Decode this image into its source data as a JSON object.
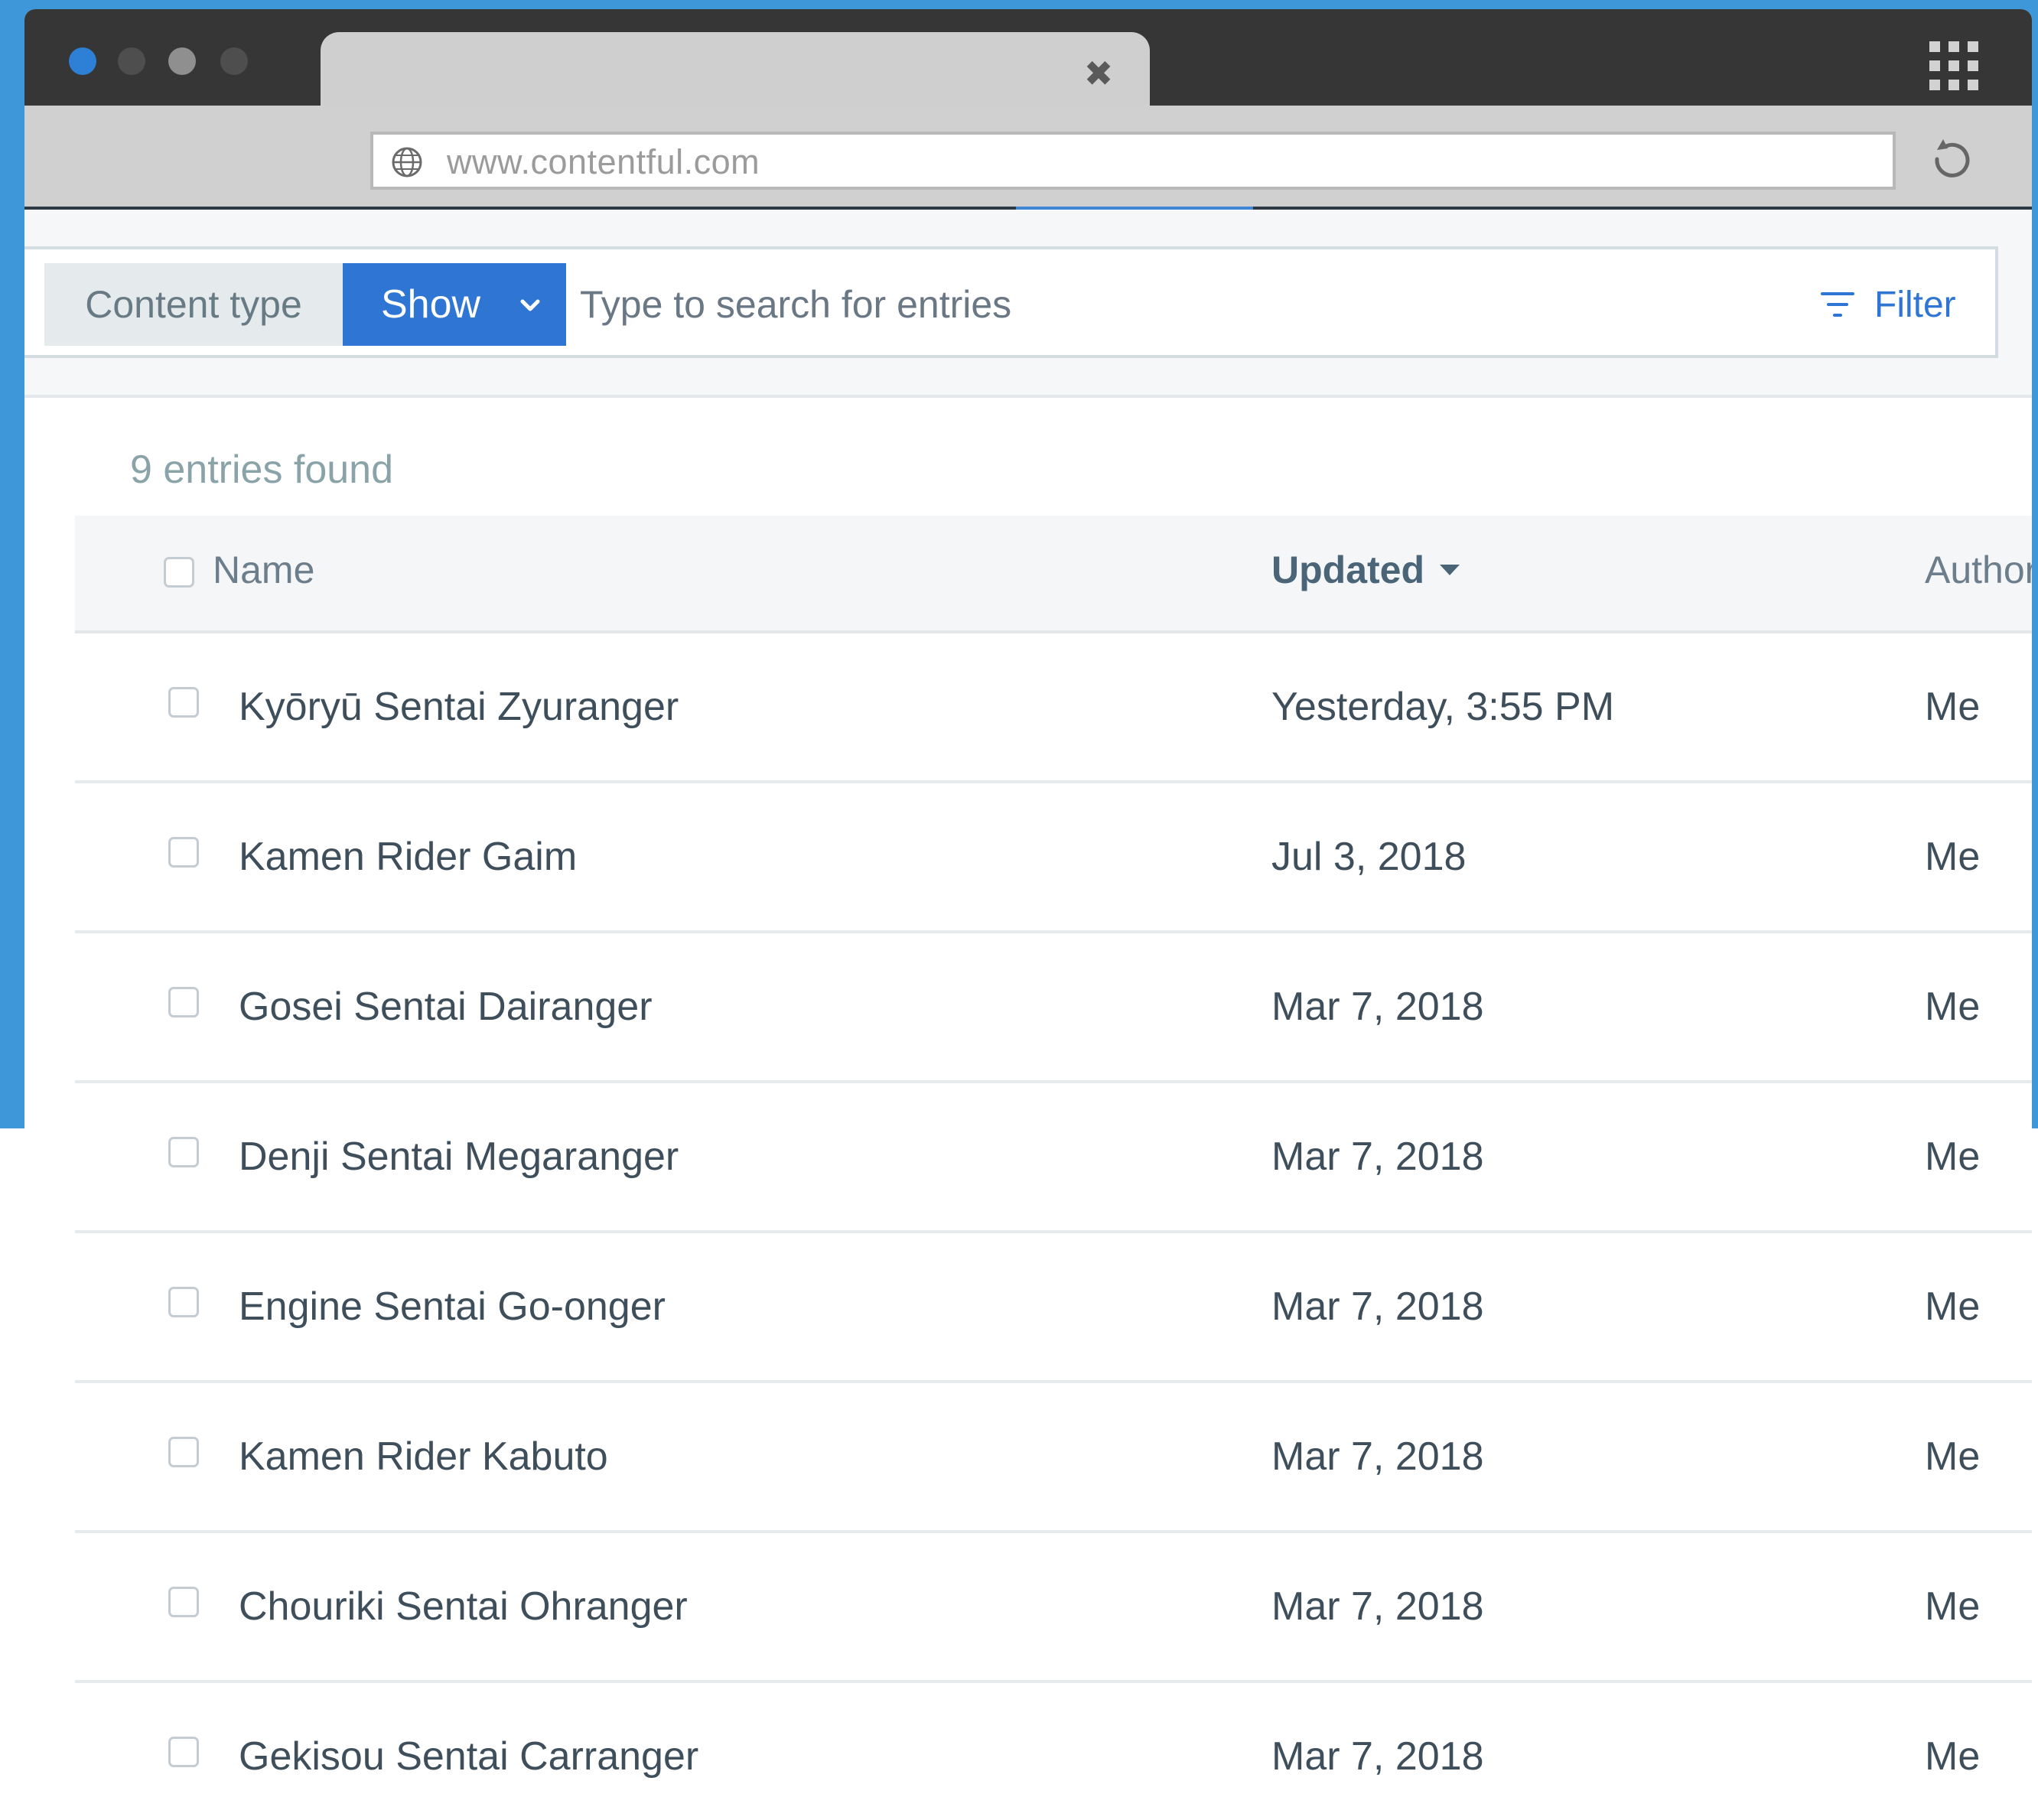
{
  "browser": {
    "window_dots": [
      "#2e7fd6",
      "#4e4e4e",
      "#8f8f8f",
      "#4e4e4e"
    ],
    "tab_close_icon": "close-icon",
    "apps_icon": "grid-icon",
    "url": "www.contentful.com",
    "globe_icon": "globe-icon",
    "reload_icon": "reload-icon"
  },
  "search": {
    "content_type_label": "Content type",
    "show_label": "Show",
    "placeholder": "Type to search for entries",
    "filter_label": "Filter"
  },
  "results": {
    "count_text": "9 entries found"
  },
  "table": {
    "columns": {
      "name": "Name",
      "updated": "Updated",
      "author": "Author"
    },
    "rows": [
      {
        "name": "Kyōryū Sentai Zyuranger",
        "updated": "Yesterday, 3:55 PM",
        "author": "Me"
      },
      {
        "name": "Kamen Rider Gaim",
        "updated": "Jul 3, 2018",
        "author": "Me"
      },
      {
        "name": "Gosei Sentai Dairanger",
        "updated": "Mar 7, 2018",
        "author": "Me"
      },
      {
        "name": "Denji Sentai Megaranger",
        "updated": "Mar 7, 2018",
        "author": "Me"
      },
      {
        "name": "Engine Sentai Go-onger",
        "updated": "Mar 7, 2018",
        "author": "Me"
      },
      {
        "name": "Kamen Rider Kabuto",
        "updated": "Mar 7, 2018",
        "author": "Me"
      },
      {
        "name": "Chouriki Sentai Ohranger",
        "updated": "Mar 7, 2018",
        "author": "Me"
      },
      {
        "name": "Gekisou Sentai Carranger",
        "updated": "Mar 7, 2018",
        "author": "Me"
      }
    ]
  },
  "colors": {
    "background_blue": "#3d97d9",
    "accent": "#2e75d4"
  }
}
